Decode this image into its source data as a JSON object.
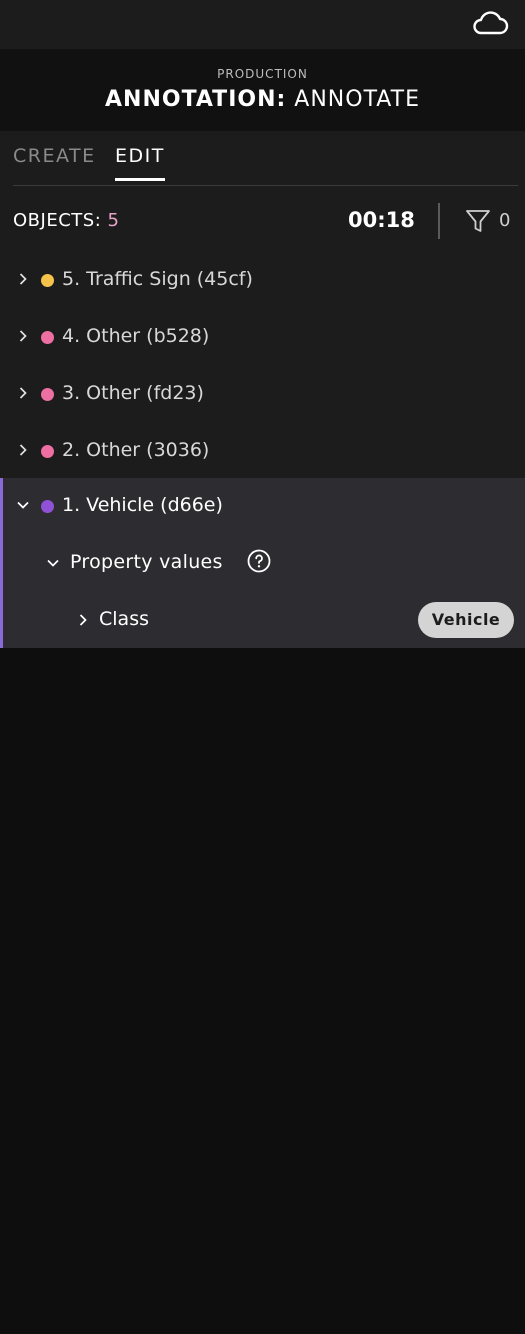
{
  "header": {
    "environment": "PRODUCTION",
    "title_strong": "ANNOTATION:",
    "title_rest": " ANNOTATE"
  },
  "tabs": [
    {
      "label": "CREATE",
      "active": false
    },
    {
      "label": "EDIT",
      "active": true
    }
  ],
  "objects": {
    "label": "OBJECTS:",
    "count": "5",
    "timer": "00:18",
    "filter_count": "0"
  },
  "list": [
    {
      "label": "5. Traffic Sign (45cf)",
      "color": "#f5c24c"
    },
    {
      "label": "4. Other (b528)",
      "color": "#ee6fa2"
    },
    {
      "label": "3. Other (fd23)",
      "color": "#ee6fa2"
    },
    {
      "label": "2. Other (3036)",
      "color": "#ee6fa2"
    }
  ],
  "selected": {
    "label": "1. Vehicle (d66e)",
    "color": "#8f52d6",
    "property_values_label": "Property values",
    "class_label": "Class",
    "class_value": "Vehicle"
  }
}
